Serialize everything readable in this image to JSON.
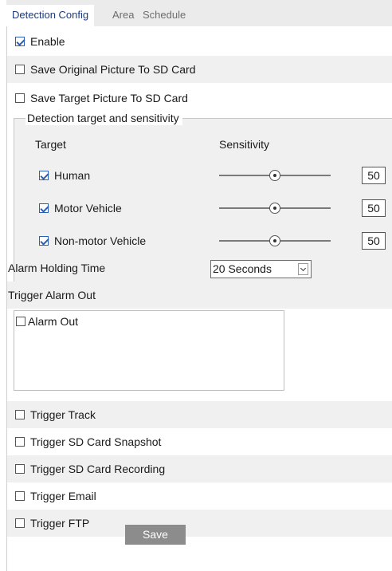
{
  "tabs": [
    {
      "label": "Detection Config",
      "active": true
    },
    {
      "label": "Area",
      "active": false
    },
    {
      "label": "Schedule",
      "active": false
    }
  ],
  "enable": {
    "label": "Enable",
    "checked": true
  },
  "save_original": {
    "label": "Save Original Picture To SD Card",
    "checked": false
  },
  "save_target": {
    "label": "Save Target Picture To SD Card",
    "checked": false
  },
  "detection": {
    "legend": "Detection target and sensitivity",
    "target_header": "Target",
    "sensitivity_header": "Sensitivity",
    "targets": [
      {
        "label": "Human",
        "checked": true,
        "sensitivity": "50",
        "level": 0.5
      },
      {
        "label": "Motor Vehicle",
        "checked": true,
        "sensitivity": "50",
        "level": 0.5
      },
      {
        "label": "Non-motor Vehicle",
        "checked": true,
        "sensitivity": "50",
        "level": 0.5
      }
    ]
  },
  "alarm_holding": {
    "label": "Alarm Holding Time",
    "value": "20 Seconds"
  },
  "trigger_alarm_out": {
    "label": "Trigger Alarm Out",
    "items": [
      {
        "label": "Alarm Out",
        "checked": false
      }
    ]
  },
  "triggers": [
    {
      "label": "Trigger Track",
      "checked": false
    },
    {
      "label": "Trigger SD Card Snapshot",
      "checked": false
    },
    {
      "label": "Trigger SD Card Recording",
      "checked": false
    },
    {
      "label": "Trigger Email",
      "checked": false
    },
    {
      "label": "Trigger FTP",
      "checked": false
    }
  ],
  "save_button": "Save",
  "colors": {
    "accent": "#2c5eb5",
    "tab_active_text": "#1e3a7a",
    "row_shade": "#f0f0f0",
    "save_bg": "#8c8c8c"
  }
}
